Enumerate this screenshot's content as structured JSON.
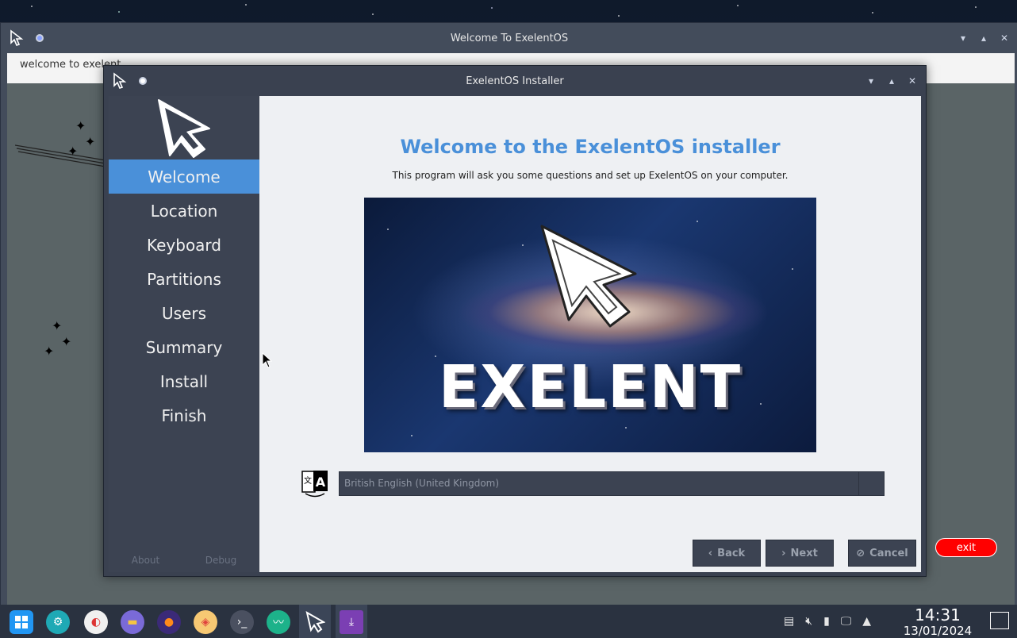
{
  "background_window": {
    "title": "Welcome To ExelentOS",
    "text": "welcome to exelent"
  },
  "installer": {
    "title": "ExelentOS Installer",
    "sidebar": {
      "items": [
        "Welcome",
        "Location",
        "Keyboard",
        "Partitions",
        "Users",
        "Summary",
        "Install",
        "Finish"
      ],
      "active_index": 0,
      "footer": {
        "about": "About",
        "debug": "Debug"
      }
    },
    "main": {
      "heading": "Welcome to the ExelentOS installer",
      "subtitle": "This program will ask you some questions and set up ExelentOS on your computer.",
      "banner_text": "EXELENT",
      "language": {
        "selected": "British English (United Kingdom)"
      },
      "buttons": {
        "back": "Back",
        "next": "Next",
        "cancel": "Cancel"
      }
    }
  },
  "exit_button": "exit",
  "taskbar": {
    "clock_time": "14:31",
    "clock_date": "13/01/2024"
  },
  "colors": {
    "accent": "#4a90d9",
    "exit": "#ff0000"
  },
  "icons": [
    "cursor-logo-icon",
    "start-menu-icon",
    "settings-icon",
    "toggle-app-icon",
    "files-icon",
    "firefox-icon",
    "store-icon",
    "terminal-icon",
    "system-monitor-icon",
    "exelent-icon",
    "installer-icon",
    "clipboard-icon",
    "mute-icon",
    "usb-icon",
    "network-icon",
    "tray-expand-icon",
    "show-desktop-icon",
    "translate-icon"
  ]
}
